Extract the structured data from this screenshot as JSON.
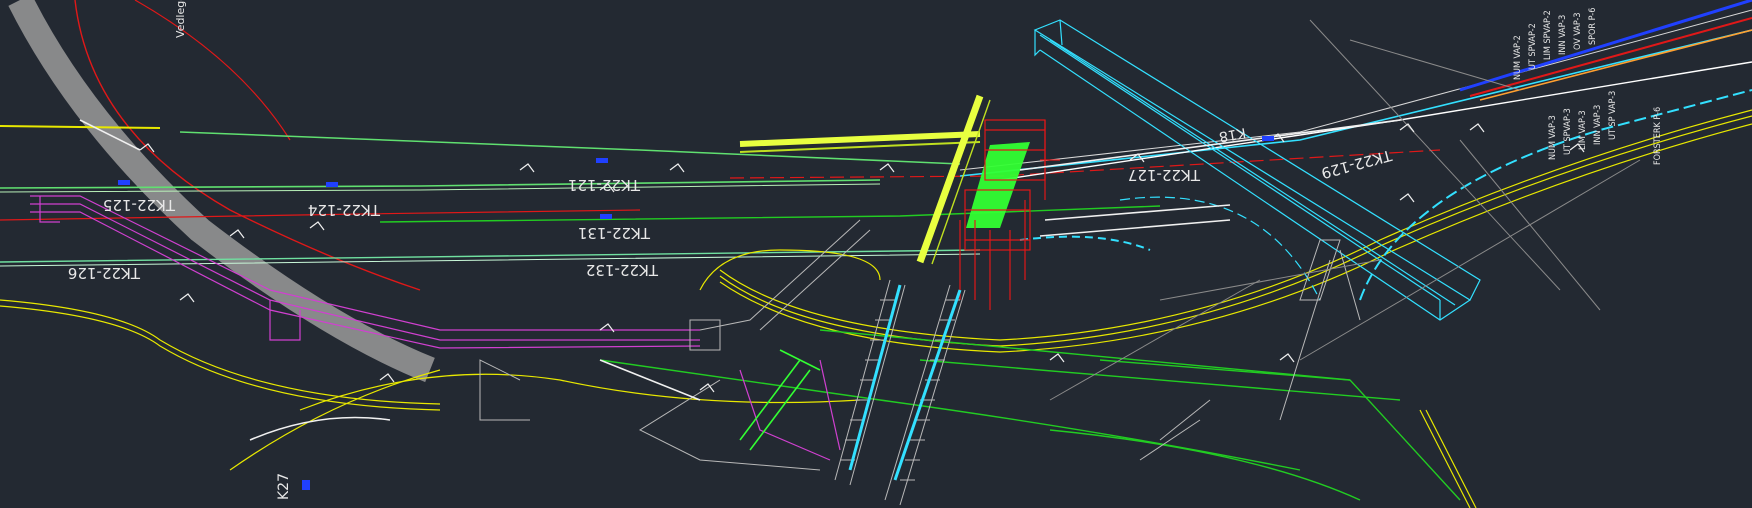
{
  "drawing": {
    "background": "#232932",
    "colors": {
      "yellow": "#e8e800",
      "green": "#22cc22",
      "bright_green": "#33ff33",
      "cyan": "#33e0ff",
      "magenta": "#d040d0",
      "red": "#e01818",
      "white": "#f0f0f0",
      "gray": "#8a8a8a",
      "orange": "#ffa030",
      "blue": "#2040ff",
      "hatch": "#b8b8b8"
    }
  },
  "labels": {
    "vedlegg": "Vedlegg",
    "tk124": "TK22-124",
    "tk125": "TK22-125",
    "tk126": "TK22-126",
    "tk131": "TK22-131",
    "tk132": "TK22-132",
    "tk121": "TK22-121",
    "tk127": "TK22-127",
    "tk129": "TK22-129",
    "k18": "K18",
    "k27": "K27"
  },
  "cable_tags_top": [
    "NUM VAP-2",
    "UT SPVAP-2",
    "LIM SPVAP-2",
    "INN VAP-3",
    "OV VAP-3",
    "SPOR P-6"
  ],
  "cable_tags_bottom": [
    "NUM VAP-3",
    "UT SPVAP-3",
    "LIM VAP-3",
    "INN VAP-3",
    "UT SP VAP-3",
    "FORSTERK P-6"
  ]
}
